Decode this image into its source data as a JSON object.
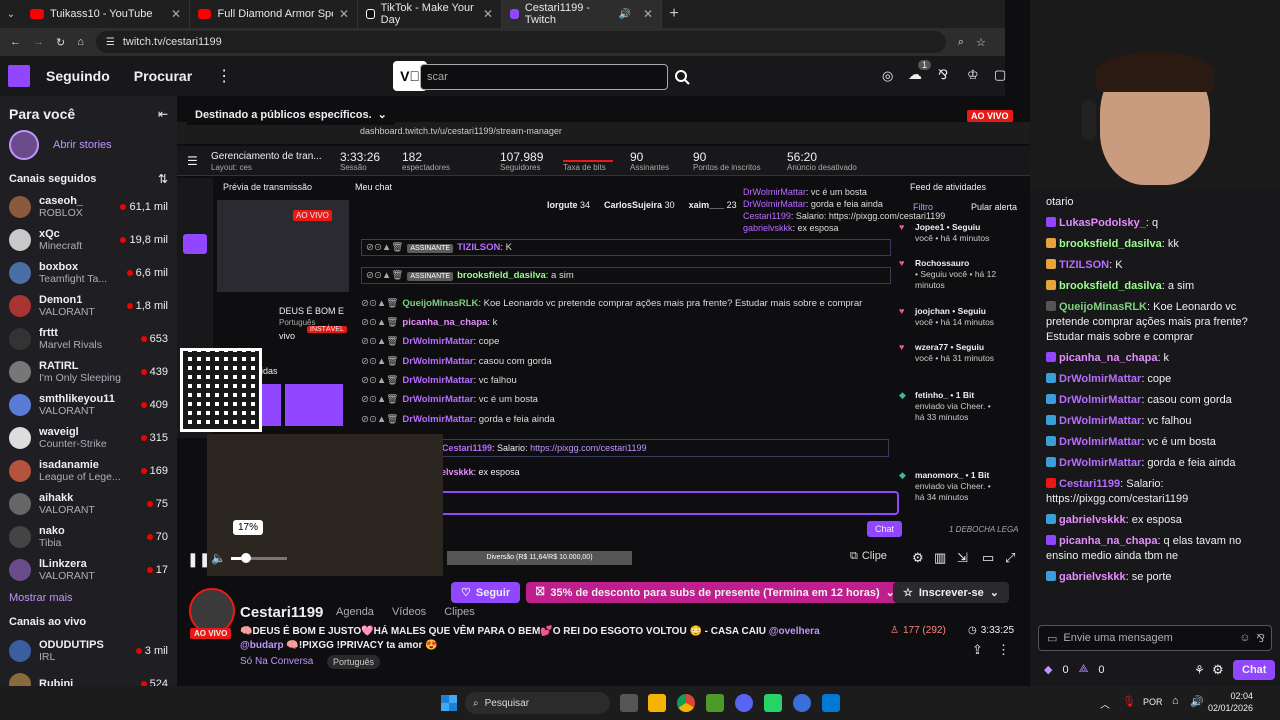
{
  "tabs": [
    {
      "label": "Tuikass10 - YouTube",
      "color": "#ff0000"
    },
    {
      "label": "Full Diamond Armor Speedrun",
      "color": "#ff0000"
    },
    {
      "label": "TikTok - Make Your Day",
      "color": "#ffffff"
    },
    {
      "label": "Cestari1199 - Twitch",
      "color": "#9147ff"
    }
  ],
  "address": "twitch.tv/cestari1199",
  "topnav": {
    "following": "Seguindo",
    "browse": "Procurar",
    "search_placeholder": "scar",
    "notif_count": "1"
  },
  "sidebar": {
    "for_you": "Para você",
    "stories": "Abrir stories",
    "followed_title": "Canais seguidos",
    "channels": [
      {
        "name": "caseoh_",
        "game": "ROBLOX",
        "viewers": "61,1 mil",
        "color": "#8a5a3c"
      },
      {
        "name": "xQc",
        "game": "Minecraft",
        "viewers": "19,8 mil",
        "color": "#c9c9c9"
      },
      {
        "name": "boxbox",
        "game": "Teamfight Ta...",
        "viewers": "6,6 mil",
        "color": "#4a6fa5"
      },
      {
        "name": "Demon1",
        "game": "VALORANT",
        "viewers": "1,8 mil",
        "color": "#a33"
      },
      {
        "name": "frttt",
        "game": "Marvel Rivals",
        "viewers": "653",
        "color": "#333"
      },
      {
        "name": "RATIRL",
        "game": "I'm Only Sleeping",
        "viewers": "439",
        "color": "#777"
      },
      {
        "name": "smthlikeyou11",
        "game": "VALORANT",
        "viewers": "409",
        "color": "#5a7bd5"
      },
      {
        "name": "waveigl",
        "game": "Counter-Strike",
        "viewers": "315",
        "color": "#ddd"
      },
      {
        "name": "isadanamie",
        "game": "League of Lege...",
        "viewers": "169",
        "color": "#b5533c"
      },
      {
        "name": "aihakk",
        "game": "VALORANT",
        "viewers": "75",
        "color": "#666"
      },
      {
        "name": "nako",
        "game": "Tibia",
        "viewers": "70",
        "color": "#444"
      },
      {
        "name": "lLinkzera",
        "game": "VALORANT",
        "viewers": "17",
        "color": "#6b4c8a"
      }
    ],
    "show_more": "Mostrar mais",
    "live_title": "Canais ao vivo",
    "live": [
      {
        "name": "ODUDUTIPS",
        "game": "IRL",
        "viewers": "3 mil",
        "color": "#3a5fa0"
      },
      {
        "name": "Rubini",
        "game": "",
        "viewers": "524",
        "color": "#8a6a3a"
      }
    ]
  },
  "video": {
    "audience_banner": "Destinado a públicos específicos.",
    "volume": "17%",
    "clip": "Clipe",
    "chat_btn": "Chat",
    "dashboard": {
      "url": "dashboard.twitch.tv/u/cestari1199/stream-manager",
      "layout": "Gerenciamento de tran...",
      "layout_sub": "Layout: ces",
      "session": "3:33:26",
      "session_l": "Sessão",
      "viewers": "182",
      "viewers_l": "espectadores",
      "followers": "107.989",
      "followers_l": "Seguidores",
      "bits_l": "Taxa de bits",
      "subs": "90",
      "subs_l": "Assinantes",
      "points": "90",
      "points_l": "Pontos de inscritos",
      "ad": "56:20",
      "ad_l": "Anúncio desativado",
      "preview": "Prévia de transmissão",
      "mychat": "Meu chat",
      "activity": "Feed de atividades",
      "filter": "Filtro",
      "skip_alert": "Pular alerta",
      "live_badge": "AO VIVO",
      "leaders": [
        {
          "name": "lorgute",
          "val": "34"
        },
        {
          "name": "CarlosSujeira",
          "val": "30"
        },
        {
          "name": "xaim___",
          "val": "23"
        }
      ],
      "lines": [
        {
          "user": "TIZILSON",
          "msg": ": K",
          "color": "#b86bff",
          "badge": "ASSINANTE"
        },
        {
          "user": "brooksfield_dasilva",
          "msg": ": a sim",
          "color": "#9aff8a",
          "badge": "ASSINANTE"
        },
        {
          "user": "QueijoMinasRLK",
          "msg": ": Koe Leonardo vc pretende comprar ações mais pra frente? Estudar mais sobre e comprar",
          "color": "#7fd07f",
          "badge": ""
        },
        {
          "user": "picanha_na_chapa",
          "msg": ": k",
          "color": "#e58cff",
          "badge": ""
        },
        {
          "user": "DrWolmirMattar",
          "msg": ": cope",
          "color": "#b86bff",
          "badge": ""
        },
        {
          "user": "DrWolmirMattar",
          "msg": ": casou com gorda",
          "color": "#b86bff",
          "badge": ""
        },
        {
          "user": "DrWolmirMattar",
          "msg": ": vc falhou",
          "color": "#b86bff",
          "badge": ""
        },
        {
          "user": "DrWolmirMattar",
          "msg": ": vc é um bosta",
          "color": "#b86bff",
          "badge": ""
        },
        {
          "user": "DrWolmirMattar",
          "msg": ": gorda e feia ainda",
          "color": "#b86bff",
          "badge": ""
        }
      ],
      "pinned_user": "Cestari1199",
      "pinned_msg": ": Salario: ",
      "pinned_link": "https://pixgg.com/cestari1199",
      "last_user": "elvskkk",
      "last_msg": ": ex esposa",
      "mini_top": [
        {
          "user": "DrWolmirMattar",
          "msg": ": vc é um bosta"
        },
        {
          "user": "DrWolmirMattar",
          "msg": ": gorda e feia ainda"
        },
        {
          "user": "Cestari1199",
          "msg": ": Salario: https://pixgg.com/cestari1199"
        },
        {
          "user": "gabrielvskkk",
          "msg": ": ex esposa"
        }
      ],
      "feed": [
        {
          "title": "Jopee1 • Seguiu",
          "sub": "você • há 4 minutos"
        },
        {
          "title": "Rochossauro",
          "sub": "• Seguiu você • há 12 minutos"
        },
        {
          "title": "joojchan • Seguiu",
          "sub": "você • há 14 minutos"
        },
        {
          "title": "wzera77 • Seguiu",
          "sub": "você • há 31 minutos"
        },
        {
          "title": "fetinho_ • 1 Bit",
          "sub": "enviado via Cheer. • há 33 minutos"
        },
        {
          "title": "manomorx_ • 1 Bit",
          "sub": "enviado via Cheer. • há 34 minutos"
        }
      ],
      "feed_last": "1 DEBOCHA LEGA",
      "preview_title": "DEUS É BOM E",
      "preview_lang": "Português",
      "preview_status": "INSTÁVEL",
      "preview_live": "vivo",
      "preview_ads": "idas",
      "donation_bar": "Diversão (R$ 11,64/R$ 10.000,00)"
    }
  },
  "stream": {
    "follow": "Seguir",
    "promo": "35% de desconto para subs de presente (Termina em 12 horas)",
    "subscribe": "Inscrever-se",
    "channel": "Cestari1199",
    "nav": [
      "Agenda",
      "Vídeos",
      "Clipes"
    ],
    "live": "AO VIVO",
    "title_line1": "🧠DEUS É BOM E JUSTO🩷HÁ MALES QUE VÊM PARA O BEM💕O REI DO ESGOTO VOLTOU 😳 - CASA CAIU ",
    "mention1": "@ovelhera",
    "mention2": "@budarp",
    "title_line2": " 🧠!PIXGG !PRIVACY ta amor 😍",
    "category": "Só Na Conversa",
    "tag": "Português",
    "viewers": "177 (292)",
    "uptime": "3:33:25"
  },
  "chat": {
    "top": "otario",
    "messages": [
      {
        "user": "LukasPodolsky_",
        "msg": ": q",
        "color": "#e58cff",
        "badge": "#9147ff"
      },
      {
        "user": "brooksfield_dasilva",
        "msg": ": kk",
        "color": "#9aff8a",
        "badge": "#e8a33a"
      },
      {
        "user": "TIZILSON",
        "msg": ": K",
        "color": "#b86bff",
        "badge": "#e8a33a"
      },
      {
        "user": "brooksfield_dasilva",
        "msg": ": a sim",
        "color": "#9aff8a",
        "badge": "#e8a33a"
      },
      {
        "user": "QueijoMinasRLK",
        "msg": ": Koe Leonardo vc pretende comprar ações mais pra frente? Estudar mais sobre e comprar",
        "color": "#7fd07f",
        "badge": "#555"
      },
      {
        "user": "picanha_na_chapa",
        "msg": ": k",
        "color": "#e58cff",
        "badge": "#9147ff"
      },
      {
        "user": "DrWolmirMattar",
        "msg": ": cope",
        "color": "#b86bff",
        "badge": "#3a9fd8"
      },
      {
        "user": "DrWolmirMattar",
        "msg": ": casou com gorda",
        "color": "#b86bff",
        "badge": "#3a9fd8"
      },
      {
        "user": "DrWolmirMattar",
        "msg": ": vc falhou",
        "color": "#b86bff",
        "badge": "#3a9fd8"
      },
      {
        "user": "DrWolmirMattar",
        "msg": ": vc é um bosta",
        "color": "#b86bff",
        "badge": "#3a9fd8"
      },
      {
        "user": "DrWolmirMattar",
        "msg": ": gorda e feia ainda",
        "color": "#b86bff",
        "badge": "#3a9fd8"
      },
      {
        "user": "Cestari1199",
        "msg": ": Salario: https://pixgg.com/cestari1199",
        "color": "#b86bff",
        "badge": "#e91916"
      },
      {
        "user": "gabrielvskkk",
        "msg": ": ex esposa",
        "color": "#e58cff",
        "badge": "#3a9fd8"
      },
      {
        "user": "picanha_na_chapa",
        "msg": ": q elas tavam no ensino medio ainda tbm ne",
        "color": "#e58cff",
        "badge": "#9147ff"
      },
      {
        "user": "gabrielvskkk",
        "msg": ": se porte",
        "color": "#e58cff",
        "badge": "#3a9fd8"
      }
    ],
    "placeholder": "Envie uma mensagem",
    "bits": "0",
    "points": "0",
    "send": "Chat"
  },
  "taskbar": {
    "search": "Pesquisar",
    "lang": "POR",
    "time": "02:04",
    "date": "02/01/2026"
  },
  "colors": {
    "accent": "#9147ff",
    "live": "#eb0400",
    "promo": "#bf1f8c"
  }
}
